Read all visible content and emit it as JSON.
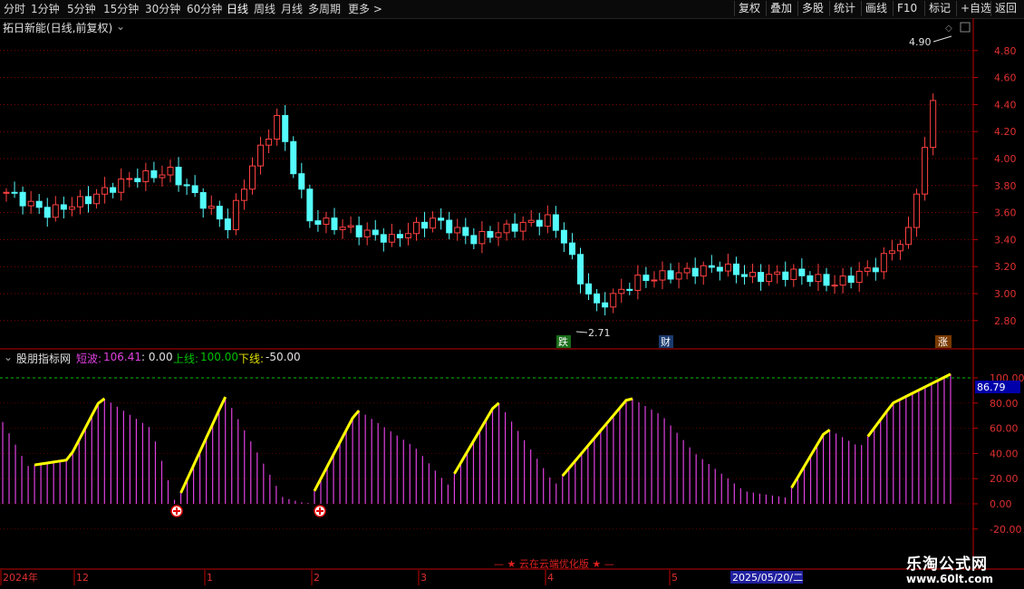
{
  "toolbar": {
    "periods": [
      "分时",
      "1分钟",
      "5分钟",
      "15分钟",
      "30分钟",
      "60分钟",
      "日线",
      "周线",
      "月线",
      "多周期",
      "更多 >"
    ],
    "active_period": "日线",
    "right_buttons": [
      "复权",
      "叠加",
      "多股",
      "统计",
      "画线",
      "F10",
      "标记",
      "+自选",
      "返回"
    ]
  },
  "main_chart": {
    "title": "拓日新能(日线,前复权)",
    "y_ticks": [
      "4.80",
      "4.60",
      "4.40",
      "4.20",
      "4.00",
      "3.80",
      "3.60",
      "3.40",
      "3.20",
      "3.00",
      "2.80"
    ],
    "high_label": "4.90",
    "low_label": "2.71",
    "markers": [
      "跌",
      "财",
      "涨"
    ],
    "colors": {
      "up": "#ff4040",
      "down": "#54fcfc",
      "grid": "#8b0000",
      "axis": "#c00000"
    }
  },
  "indicator": {
    "name": "股朋指标网",
    "short_wave_label": "短波:",
    "short_wave_value": "106.41",
    "sep_value": ": 0.00",
    "upper_label": "上线:",
    "upper_value": "100.00",
    "lower_label": "下线:",
    "lower_value": "-50.00",
    "y_ticks": [
      "100.00",
      "80.00",
      "60.00",
      "40.00",
      "20.00",
      "0.00",
      "-20.00"
    ],
    "current_value": "86.79",
    "colors": {
      "bar": "#e040e0",
      "line": "#ffff00",
      "upper": "#00c000"
    }
  },
  "footer": {
    "banner": "云在云端优化版",
    "dates": [
      "2024年",
      "12",
      "1",
      "2",
      "3",
      "4",
      "5"
    ],
    "selected_date": "2025/05/20/二"
  },
  "watermark": {
    "title": "乐淘公式网",
    "url": "www.60lt.com"
  }
}
